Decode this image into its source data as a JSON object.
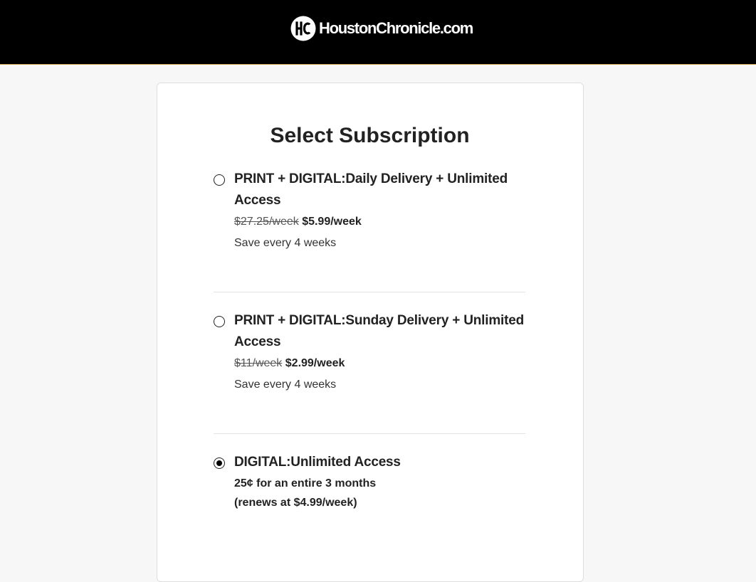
{
  "header": {
    "brand_name": "HoustonChronicle.com",
    "logo_icon": "hc-logo-icon",
    "background": "#000000",
    "accent": "#d4a94a"
  },
  "page": {
    "title": "Select Subscription"
  },
  "options": [
    {
      "title_line1": "PRINT + DIGITAL:Daily Delivery + Unlimited",
      "title_line2": "Access",
      "old_price": "$27.25/week",
      "new_price": "$5.99/week",
      "save_text": "Save every 4 weeks",
      "selected": false
    },
    {
      "title_line1": "PRINT + DIGITAL:Sunday Delivery + Unlimited",
      "title_line2": "Access",
      "old_price": "$11/week",
      "new_price": "$2.99/week",
      "save_text": "Save every 4 weeks",
      "selected": false
    },
    {
      "title_line1": "DIGITAL:Unlimited Access",
      "promo_line1": "25¢ for an entire 3 months",
      "promo_line2": "(renews at $4.99/week)",
      "selected": true
    }
  ]
}
